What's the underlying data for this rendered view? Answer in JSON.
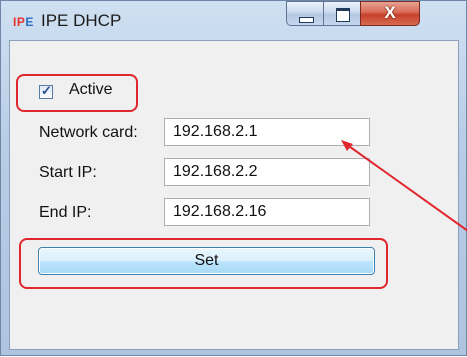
{
  "window": {
    "app_icon_text": "IPE",
    "title": "IPE DHCP",
    "controls": {
      "minimize": "minimize",
      "maximize": "maximize",
      "close": "X"
    }
  },
  "form": {
    "active_label": "Active",
    "active_checked": true,
    "network_card_label": "Network card:",
    "network_card_value": "192.168.2.1",
    "start_ip_label": "Start IP:",
    "start_ip_value": "192.168.2.2",
    "end_ip_label": "End IP:",
    "end_ip_value": "192.168.2.16",
    "set_button_label": "Set"
  },
  "annotation": {
    "highlight_color": "#e0272e"
  }
}
